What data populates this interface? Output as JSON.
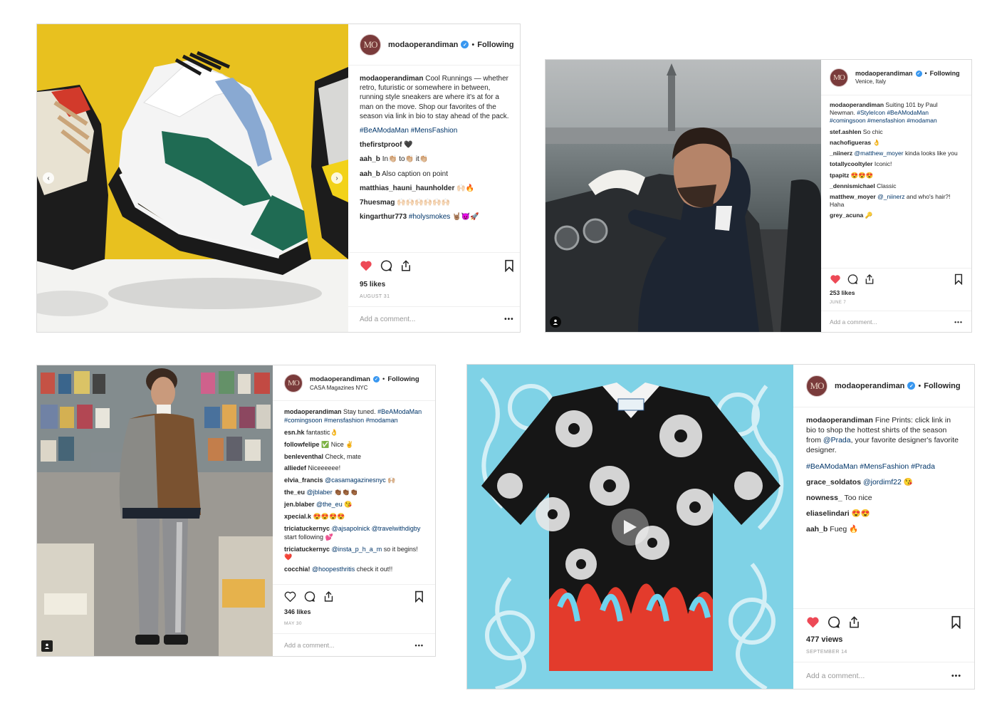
{
  "colors": {
    "link": "#003569",
    "verified": "#3897f0",
    "like": "#ed4956",
    "muted": "#999999",
    "avatar": "#7a3b3b"
  },
  "avatar_initials": "MO",
  "posts": [
    {
      "username": "modaoperandiman",
      "follow_label": "Following",
      "dot": "•",
      "caption_parts": [
        "Cool Runnings — whether retro, futuristic or somewhere in between, running style sneakers are where it's at for a man on the move. Shop our favorites of the season via link in bio to stay ahead of the pack."
      ],
      "hashtags": "#BeAModaMan #MensFashion",
      "comments": [
        {
          "user": "thefirstproof",
          "text": "🖤"
        },
        {
          "user": "aah_b",
          "text": "In👏🏼 to👏🏼 it👏🏼"
        },
        {
          "user": "aah_b",
          "text": "Also caption on point"
        },
        {
          "user": "matthias_hauni_haunholder",
          "text": "🙌🏻🔥"
        },
        {
          "user": "7huesmag",
          "text": "🙌🏻🙌🏻🙌🏻🙌🏻🙌🏻🙌🏻"
        },
        {
          "user": "kingarthur773",
          "mention": "#holysmokes",
          "text": "🤘🏽😈🚀"
        }
      ],
      "likes": "95 likes",
      "date": "AUGUST 31",
      "add_comment": "Add a comment...",
      "more": "•••",
      "liked": true,
      "icons": {
        "like": "heart-icon",
        "comment": "comment-icon",
        "share": "share-icon",
        "save": "bookmark-icon"
      }
    },
    {
      "username": "modaoperandiman",
      "follow_label": "Following",
      "dot": "•",
      "location": "Venice, Italy",
      "caption": "Suiting 101 by Paul Newman.",
      "hashtags": "#StyleIcon #BeAModaMan #comingsoon #mensfashion #modaman",
      "comments": [
        {
          "user": "stef.ashlen",
          "text": "So chic"
        },
        {
          "user": "nachofigueras",
          "text": "👌"
        },
        {
          "user": "_niinerz",
          "mention": "@matthew_moyer",
          "text": "kinda looks like you"
        },
        {
          "user": "totallycooltyler",
          "text": "Iconic!"
        },
        {
          "user": "tpapitz",
          "text": "😍😍😍"
        },
        {
          "user": "_dennismichael",
          "text": "Classic"
        },
        {
          "user": "matthew_moyer",
          "mention": "@_niinerz",
          "text": "and who's hair?! Haha"
        },
        {
          "user": "grey_acuna",
          "text": "🔑"
        }
      ],
      "likes": "253 likes",
      "date": "JUNE 7",
      "add_comment": "Add a comment...",
      "more": "•••",
      "liked": true
    },
    {
      "username": "modaoperandiman",
      "follow_label": "Following",
      "dot": "•",
      "location": "CASA Magazines NYC",
      "caption": "Stay tuned.",
      "hashtags": "#BeAModaMan #comingsoon #mensfashion #modaman",
      "comments": [
        {
          "user": "esn.hk",
          "text": "fantastic👌"
        },
        {
          "user": "followfelipe",
          "text": "✅ Nice ✌️"
        },
        {
          "user": "benleventhal",
          "text": "Check, mate"
        },
        {
          "user": "alliedef",
          "text": "Niceeeeee!"
        },
        {
          "user": "elvia_francis",
          "mention": "@casamagazinesnyc",
          "text": "🙌🏼"
        },
        {
          "user": "the_eu",
          "mention": "@jblaber",
          "text": "👏🏾👏🏾👏🏾"
        },
        {
          "user": "jen.blaber",
          "mention": "@the_eu",
          "text": "😘"
        },
        {
          "user": "xpecial.k",
          "text": "😍😍😍😍"
        },
        {
          "user": "triciatuckernyc",
          "mention": "@ajsapolnick @travelwithdigby",
          "text": "start following 💕"
        },
        {
          "user": "triciatuckernyc",
          "mention": "@insta_p_h_a_m",
          "text": "so it begins! ❤️"
        },
        {
          "user": "cocchia!",
          "mention": "@hoopesthritis",
          "text": "check it out!!"
        }
      ],
      "likes": "346 likes",
      "date": "MAY 30",
      "add_comment": "Add a comment...",
      "more": "•••",
      "liked": false
    },
    {
      "username": "modaoperandiman",
      "follow_label": "Following",
      "dot": "•",
      "caption_pre": "Fine Prints: click link in bio to shop the hottest shirts of the season from",
      "caption_mention": "@Prada",
      "caption_post": ", your favorite designer's favorite designer.",
      "hashtags": "#BeAModaMan #MensFashion #Prada",
      "comments": [
        {
          "user": "grace_soldatos",
          "mention": "@jordimf22",
          "text": "😘"
        },
        {
          "user": "nowness_",
          "text": "Too nice"
        },
        {
          "user": "eliaselindari",
          "text": "😍😍"
        },
        {
          "user": "aah_b",
          "text": "Fueg 🔥"
        }
      ],
      "likes": "477 views",
      "date": "SEPTEMBER 14",
      "add_comment": "Add a comment...",
      "more": "•••",
      "liked": true
    }
  ]
}
